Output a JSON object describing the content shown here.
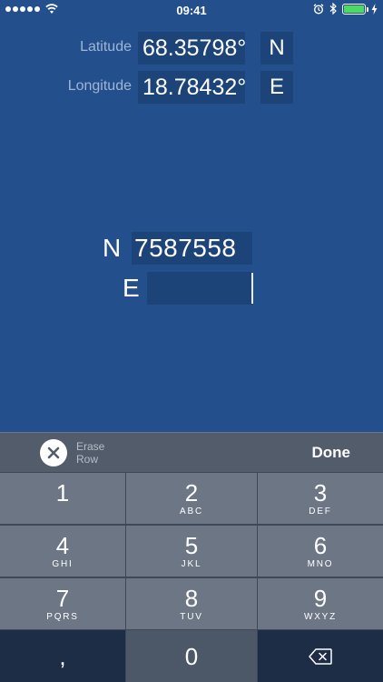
{
  "status_bar": {
    "time": "09:41",
    "signal_bars": 5,
    "battery_level": 1.0,
    "icons": [
      "signal-dots-icon",
      "wifi-icon",
      "alarm-icon",
      "bluetooth-icon",
      "battery-icon",
      "charging-icon"
    ]
  },
  "coordinates": {
    "latitude": {
      "label": "Latitude",
      "value": "68.35798°",
      "hemisphere": "N"
    },
    "longitude": {
      "label": "Longitude",
      "value": "18.78432°",
      "hemisphere": "E"
    }
  },
  "utm": {
    "north": {
      "letter": "N",
      "value": "7587558"
    },
    "east": {
      "letter": "E",
      "value": ""
    }
  },
  "toolbar": {
    "erase_label_line1": "Erase",
    "erase_label_line2": "Row",
    "done_label": "Done"
  },
  "keypad": {
    "keys": [
      {
        "digit": "1",
        "letters": ""
      },
      {
        "digit": "2",
        "letters": "ABC"
      },
      {
        "digit": "3",
        "letters": "DEF"
      },
      {
        "digit": "4",
        "letters": "GHI"
      },
      {
        "digit": "5",
        "letters": "JKL"
      },
      {
        "digit": "6",
        "letters": "MNO"
      },
      {
        "digit": "7",
        "letters": "PQRS"
      },
      {
        "digit": "8",
        "letters": "TUV"
      },
      {
        "digit": "9",
        "letters": "WXYZ"
      }
    ],
    "comma_label": ",",
    "zero_label": "0",
    "backspace_icon": "backspace-icon"
  },
  "colors": {
    "background": "#234f8c",
    "field": "#1d4478",
    "key": "#6c7685",
    "battery": "#4cd964"
  }
}
